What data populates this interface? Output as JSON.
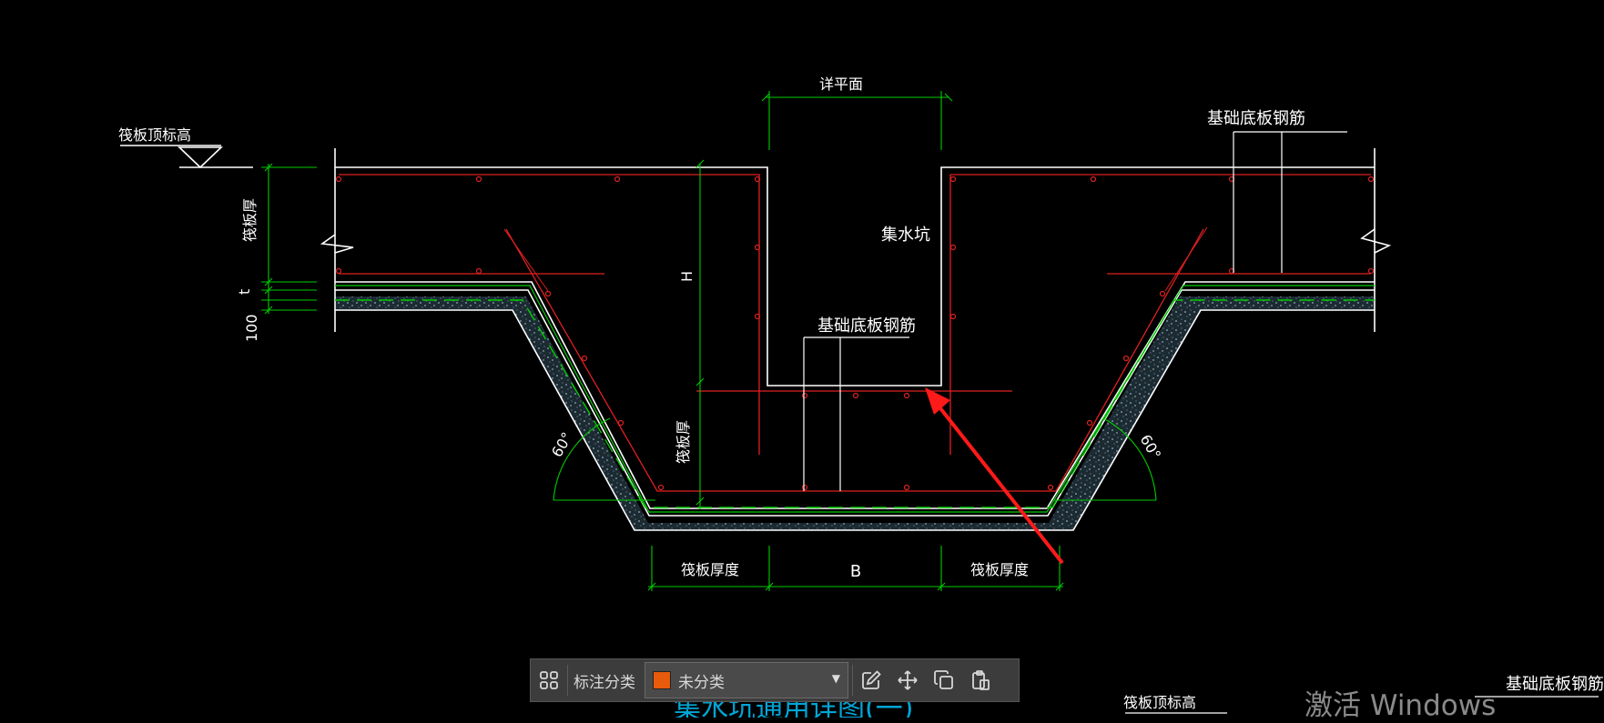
{
  "drawing": {
    "labels": {
      "raft_top_elev": "筏板顶标高",
      "detail_plan": "详平面",
      "base_rebar_top_right": "基础底板钢筋",
      "sump": "集水坑",
      "raft_thickness_vertical": "筏板厚",
      "t": "t",
      "dim_100": "100",
      "H": "H",
      "base_rebar_center": "基础底板钢筋",
      "raft_thickness_small": "筏板厚",
      "angle_left": "60°",
      "angle_right": "60°",
      "raft_thickness_left": "筏板厚度",
      "B": "B",
      "raft_thickness_right": "筏板厚度",
      "caption_partial": "集水坑通用详图(一)",
      "raft_top_elev_bottom": "筏板顶标高",
      "base_rebar_bottom_right": "基础底板钢筋"
    },
    "colors": {
      "outline": "#ffffff",
      "rebar": "#e02020",
      "dimension": "#00cc00",
      "caption": "#00a6d6",
      "arrow": "#ff1a1a"
    }
  },
  "toolbar": {
    "grid_icon": "grid-icon",
    "label": "标注分类",
    "select_value": "未分类",
    "swatch_color": "#e85a0c",
    "edit_icon": "edit-icon",
    "move_icon": "move-icon",
    "copy_icon": "copy-icon",
    "paste_icon": "paste-icon"
  },
  "watermark": "激活 Windows"
}
